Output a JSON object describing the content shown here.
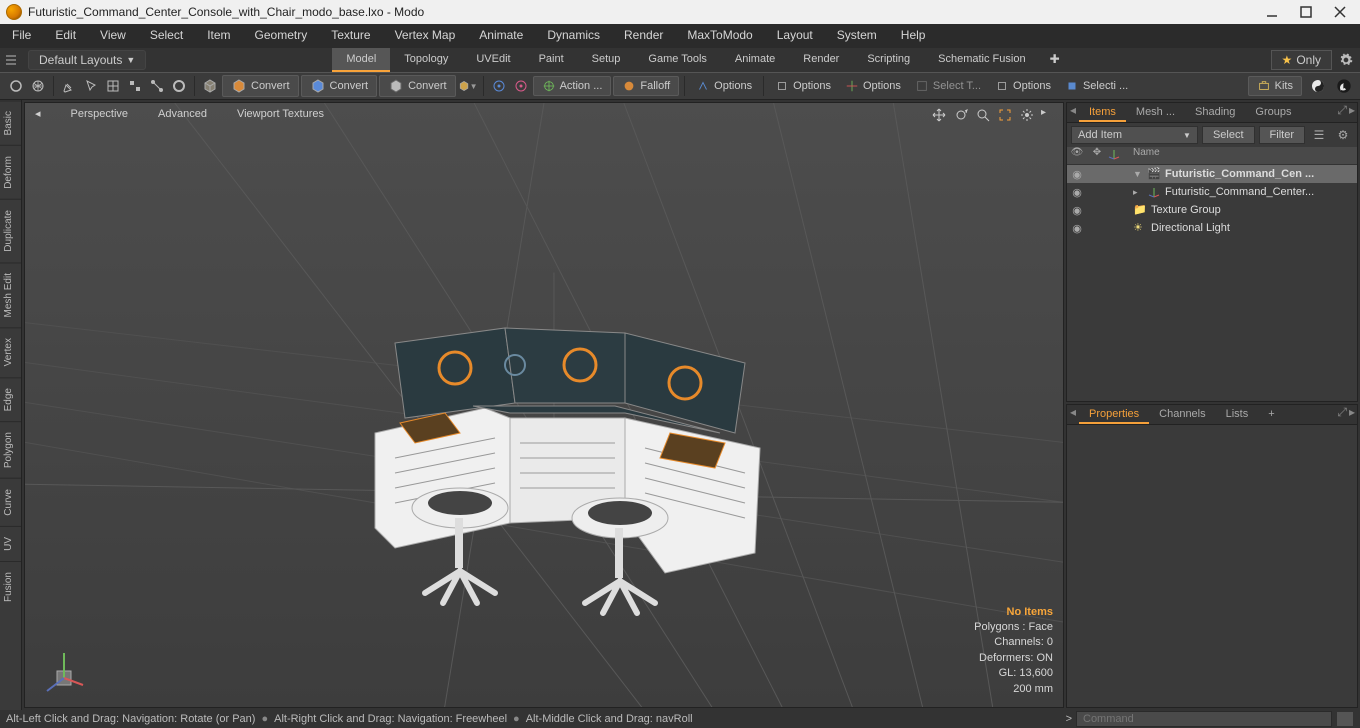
{
  "title": "Futuristic_Command_Center_Console_with_Chair_modo_base.lxo - Modo",
  "menubar": [
    "File",
    "Edit",
    "View",
    "Select",
    "Item",
    "Geometry",
    "Texture",
    "Vertex Map",
    "Animate",
    "Dynamics",
    "Render",
    "MaxToModo",
    "Layout",
    "System",
    "Help"
  ],
  "layouts_label": "Default Layouts",
  "tabs": [
    "Model",
    "Topology",
    "UVEdit",
    "Paint",
    "Setup",
    "Game Tools",
    "Animate",
    "Render",
    "Scripting",
    "Schematic Fusion"
  ],
  "active_tab": 0,
  "only_label": "Only",
  "toolbar": {
    "convert1": "Convert",
    "convert2": "Convert",
    "convert3": "Convert",
    "action": "Action  ...",
    "falloff": "Falloff",
    "options1": "Options",
    "options2": "Options",
    "options3": "Options",
    "select_t": "Select T...",
    "options4": "Options",
    "selecti": "Selecti ...",
    "kits": "Kits"
  },
  "left_tabs": [
    "Basic",
    "Deform",
    "Duplicate",
    "Mesh Edit",
    "Vertex",
    "Edge",
    "Polygon",
    "Curve",
    "UV",
    "Fusion"
  ],
  "viewport": {
    "persp": "Perspective",
    "adv": "Advanced",
    "vtex": "Viewport Textures"
  },
  "hud": {
    "noitems": "No Items",
    "polys": "Polygons : Face",
    "channels": "Channels: 0",
    "deformers": "Deformers: ON",
    "gl": "GL: 13,600",
    "mm": "200 mm"
  },
  "panel_top": {
    "tabs": [
      "Items",
      "Mesh ...",
      "Shading",
      "Groups"
    ],
    "active": 0,
    "add_item": "Add Item",
    "select": "Select",
    "filter": "Filter",
    "head_name": "Name",
    "tree": {
      "root": "Futuristic_Command_Cen ...",
      "child1": "Futuristic_Command_Center...",
      "child2": "Texture Group",
      "child3": "Directional Light"
    }
  },
  "panel_bottom": {
    "tabs": [
      "Properties",
      "Channels",
      "Lists",
      "+"
    ],
    "active": 0
  },
  "status": {
    "s1": "Alt-Left Click and Drag: Navigation: Rotate (or Pan)",
    "s2": "Alt-Right Click and Drag: Navigation: Freewheel",
    "s3": "Alt-Middle Click and Drag: navRoll",
    "prompt": ">",
    "cmd_ph": "Command"
  }
}
